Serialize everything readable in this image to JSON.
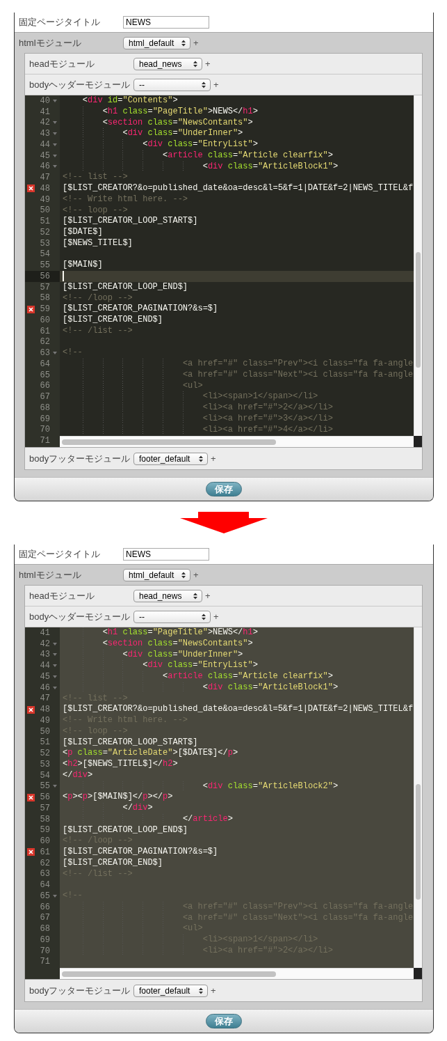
{
  "panels": [
    {
      "page_title": {
        "label": "固定ページタイトル",
        "value": "NEWS"
      },
      "html_module": {
        "label": "htmlモジュール",
        "value": "html_default",
        "add": "+"
      },
      "head_module": {
        "label": "headモジュール",
        "value": "head_news",
        "add": "+"
      },
      "body_header_module": {
        "label": "bodyヘッダーモジュール",
        "value": "--",
        "add": "+"
      },
      "editor": {
        "selected": false,
        "lines": [
          {
            "number": "40",
            "fold": true,
            "error": false,
            "active": false,
            "tokens": [
              {
                "kind": "plain",
                "text": "    <"
              },
              {
                "kind": "tag",
                "text": "div"
              },
              {
                "kind": "attr",
                "text": " id"
              },
              {
                "kind": "plain",
                "text": "="
              },
              {
                "kind": "string",
                "text": "\"Contents\""
              },
              {
                "kind": "plain",
                "text": ">"
              }
            ]
          },
          {
            "number": "41",
            "fold": false,
            "error": false,
            "active": false,
            "tokens": [
              {
                "kind": "plain",
                "text": "        <"
              },
              {
                "kind": "tag",
                "text": "h1"
              },
              {
                "kind": "attr",
                "text": " class"
              },
              {
                "kind": "plain",
                "text": "="
              },
              {
                "kind": "string",
                "text": "\"PageTitle\""
              },
              {
                "kind": "plain",
                "text": ">NEWS</"
              },
              {
                "kind": "tag",
                "text": "h1"
              },
              {
                "kind": "plain",
                "text": ">"
              }
            ]
          },
          {
            "number": "42",
            "fold": true,
            "error": false,
            "active": false,
            "tokens": [
              {
                "kind": "plain",
                "text": "        <"
              },
              {
                "kind": "tag",
                "text": "section"
              },
              {
                "kind": "attr",
                "text": " class"
              },
              {
                "kind": "plain",
                "text": "="
              },
              {
                "kind": "string",
                "text": "\"NewsContants\""
              },
              {
                "kind": "plain",
                "text": ">"
              }
            ]
          },
          {
            "number": "43",
            "fold": true,
            "error": false,
            "active": false,
            "tokens": [
              {
                "kind": "plain",
                "text": "            <"
              },
              {
                "kind": "tag",
                "text": "div"
              },
              {
                "kind": "attr",
                "text": " class"
              },
              {
                "kind": "plain",
                "text": "="
              },
              {
                "kind": "string",
                "text": "\"UnderInner\""
              },
              {
                "kind": "plain",
                "text": ">"
              }
            ]
          },
          {
            "number": "44",
            "fold": true,
            "error": false,
            "active": false,
            "tokens": [
              {
                "kind": "plain",
                "text": "                <"
              },
              {
                "kind": "tag",
                "text": "div"
              },
              {
                "kind": "attr",
                "text": " class"
              },
              {
                "kind": "plain",
                "text": "="
              },
              {
                "kind": "string",
                "text": "\"EntryList\""
              },
              {
                "kind": "plain",
                "text": ">"
              }
            ]
          },
          {
            "number": "45",
            "fold": true,
            "error": false,
            "active": false,
            "tokens": [
              {
                "kind": "plain",
                "text": "                    <"
              },
              {
                "kind": "tag",
                "text": "article"
              },
              {
                "kind": "attr",
                "text": " class"
              },
              {
                "kind": "plain",
                "text": "="
              },
              {
                "kind": "string",
                "text": "\"Article clearfix\""
              },
              {
                "kind": "plain",
                "text": ">"
              }
            ]
          },
          {
            "number": "46",
            "fold": true,
            "error": false,
            "active": false,
            "tokens": [
              {
                "kind": "plain",
                "text": "                            <"
              },
              {
                "kind": "tag",
                "text": "div"
              },
              {
                "kind": "attr",
                "text": " class"
              },
              {
                "kind": "plain",
                "text": "="
              },
              {
                "kind": "string",
                "text": "\"ArticleBlock1\""
              },
              {
                "kind": "plain",
                "text": ">"
              }
            ]
          },
          {
            "number": "47",
            "fold": false,
            "error": false,
            "active": false,
            "tokens": [
              {
                "kind": "comment",
                "text": "<!-- list -->"
              }
            ]
          },
          {
            "number": "48",
            "fold": false,
            "error": true,
            "active": false,
            "tokens": [
              {
                "kind": "plain",
                "text": "[$LIST_CREATOR?&o=published_date&oa=desc&l=5&f=1|DATE&f=2|NEWS_TITEL&f"
              }
            ]
          },
          {
            "number": "49",
            "fold": false,
            "error": false,
            "active": false,
            "tokens": [
              {
                "kind": "comment",
                "text": "<!-- Write html here. -->"
              }
            ]
          },
          {
            "number": "50",
            "fold": false,
            "error": false,
            "active": false,
            "tokens": [
              {
                "kind": "comment",
                "text": "<!-- loop -->"
              }
            ]
          },
          {
            "number": "51",
            "fold": false,
            "error": false,
            "active": false,
            "tokens": [
              {
                "kind": "plain",
                "text": "[$LIST_CREATOR_LOOP_START$]"
              }
            ]
          },
          {
            "number": "52",
            "fold": false,
            "error": false,
            "active": false,
            "tokens": [
              {
                "kind": "plain",
                "text": "[$DATE$]"
              }
            ]
          },
          {
            "number": "53",
            "fold": false,
            "error": false,
            "active": false,
            "tokens": [
              {
                "kind": "plain",
                "text": "[$NEWS_TITEL$]"
              }
            ]
          },
          {
            "number": "54",
            "fold": false,
            "error": false,
            "active": false
          },
          {
            "number": "55",
            "fold": false,
            "error": false,
            "active": false,
            "tokens": [
              {
                "kind": "plain",
                "text": "[$MAIN$]"
              }
            ]
          },
          {
            "number": "56",
            "fold": false,
            "error": false,
            "active": true
          },
          {
            "number": "57",
            "fold": false,
            "error": false,
            "active": false,
            "tokens": [
              {
                "kind": "plain",
                "text": "[$LIST_CREATOR_LOOP_END$]"
              }
            ]
          },
          {
            "number": "58",
            "fold": false,
            "error": false,
            "active": false,
            "tokens": [
              {
                "kind": "comment",
                "text": "<!-- /loop -->"
              }
            ]
          },
          {
            "number": "59",
            "fold": false,
            "error": true,
            "active": false,
            "tokens": [
              {
                "kind": "plain",
                "text": "[$LIST_CREATOR_PAGINATION?&s=$]"
              }
            ]
          },
          {
            "number": "60",
            "fold": false,
            "error": false,
            "active": false,
            "tokens": [
              {
                "kind": "plain",
                "text": "[$LIST_CREATOR_END$]"
              }
            ]
          },
          {
            "number": "61",
            "fold": false,
            "error": false,
            "active": false,
            "tokens": [
              {
                "kind": "comment",
                "text": "<!-- /list -->"
              }
            ]
          },
          {
            "number": "62",
            "fold": false,
            "error": false,
            "active": false
          },
          {
            "number": "63",
            "fold": true,
            "error": false,
            "active": false,
            "tokens": [
              {
                "kind": "comment",
                "text": "<!--"
              }
            ]
          },
          {
            "number": "64",
            "fold": false,
            "error": false,
            "active": false,
            "tokens": [
              {
                "kind": "comment",
                "text": "                        <a href=\"#\" class=\"Prev\"><i class=\"fa fa-angle"
              }
            ]
          },
          {
            "number": "65",
            "fold": false,
            "error": false,
            "active": false,
            "tokens": [
              {
                "kind": "comment",
                "text": "                        <a href=\"#\" class=\"Next\"><i class=\"fa fa-angle"
              }
            ]
          },
          {
            "number": "66",
            "fold": false,
            "error": false,
            "active": false,
            "tokens": [
              {
                "kind": "comment",
                "text": "                        <ul>"
              }
            ]
          },
          {
            "number": "67",
            "fold": false,
            "error": false,
            "active": false,
            "tokens": [
              {
                "kind": "comment",
                "text": "                            <li><span>1</span></li>"
              }
            ]
          },
          {
            "number": "68",
            "fold": false,
            "error": false,
            "active": false,
            "tokens": [
              {
                "kind": "comment",
                "text": "                            <li><a href=\"#\">2</a></li>"
              }
            ]
          },
          {
            "number": "69",
            "fold": false,
            "error": false,
            "active": false,
            "tokens": [
              {
                "kind": "comment",
                "text": "                            <li><a href=\"#\">3</a></li>"
              }
            ]
          },
          {
            "number": "70",
            "fold": false,
            "error": false,
            "active": false,
            "tokens": [
              {
                "kind": "comment",
                "text": "                            <li><a href=\"#\">4</a></li>"
              }
            ]
          },
          {
            "number": "71",
            "fold": false,
            "error": false,
            "active": false
          }
        ]
      },
      "body_footer_module": {
        "label": "bodyフッターモジュール",
        "value": "footer_default",
        "add": "+"
      },
      "save_button": "保存"
    },
    {
      "page_title": {
        "label": "固定ページタイトル",
        "value": "NEWS"
      },
      "html_module": {
        "label": "htmlモジュール",
        "value": "html_default",
        "add": "+"
      },
      "head_module": {
        "label": "headモジュール",
        "value": "head_news",
        "add": "+"
      },
      "body_header_module": {
        "label": "bodyヘッダーモジュール",
        "value": "--",
        "add": "+"
      },
      "editor": {
        "selected": true,
        "lines": [
          {
            "number": "41",
            "fold": false,
            "error": false,
            "active": false,
            "tokens": [
              {
                "kind": "plain",
                "text": "        <"
              },
              {
                "kind": "tag",
                "text": "h1"
              },
              {
                "kind": "attr",
                "text": " class"
              },
              {
                "kind": "plain",
                "text": "="
              },
              {
                "kind": "string",
                "text": "\"PageTitle\""
              },
              {
                "kind": "plain",
                "text": ">NEWS</"
              },
              {
                "kind": "tag",
                "text": "h1"
              },
              {
                "kind": "plain",
                "text": ">"
              }
            ]
          },
          {
            "number": "42",
            "fold": true,
            "error": false,
            "active": false,
            "tokens": [
              {
                "kind": "plain",
                "text": "        <"
              },
              {
                "kind": "tag",
                "text": "section"
              },
              {
                "kind": "attr",
                "text": " class"
              },
              {
                "kind": "plain",
                "text": "="
              },
              {
                "kind": "string",
                "text": "\"NewsContants\""
              },
              {
                "kind": "plain",
                "text": ">"
              }
            ]
          },
          {
            "number": "43",
            "fold": true,
            "error": false,
            "active": false,
            "tokens": [
              {
                "kind": "plain",
                "text": "            <"
              },
              {
                "kind": "tag",
                "text": "div"
              },
              {
                "kind": "attr",
                "text": " class"
              },
              {
                "kind": "plain",
                "text": "="
              },
              {
                "kind": "string",
                "text": "\"UnderInner\""
              },
              {
                "kind": "plain",
                "text": ">"
              }
            ]
          },
          {
            "number": "44",
            "fold": true,
            "error": false,
            "active": false,
            "tokens": [
              {
                "kind": "plain",
                "text": "                <"
              },
              {
                "kind": "tag",
                "text": "div"
              },
              {
                "kind": "attr",
                "text": " class"
              },
              {
                "kind": "plain",
                "text": "="
              },
              {
                "kind": "string",
                "text": "\"EntryList\""
              },
              {
                "kind": "plain",
                "text": ">"
              }
            ]
          },
          {
            "number": "45",
            "fold": true,
            "error": false,
            "active": false,
            "tokens": [
              {
                "kind": "plain",
                "text": "                    <"
              },
              {
                "kind": "tag",
                "text": "article"
              },
              {
                "kind": "attr",
                "text": " class"
              },
              {
                "kind": "plain",
                "text": "="
              },
              {
                "kind": "string",
                "text": "\"Article clearfix\""
              },
              {
                "kind": "plain",
                "text": ">"
              }
            ]
          },
          {
            "number": "46",
            "fold": true,
            "error": false,
            "active": false,
            "tokens": [
              {
                "kind": "plain",
                "text": "                            <"
              },
              {
                "kind": "tag",
                "text": "div"
              },
              {
                "kind": "attr",
                "text": " class"
              },
              {
                "kind": "plain",
                "text": "="
              },
              {
                "kind": "string",
                "text": "\"ArticleBlock1\""
              },
              {
                "kind": "plain",
                "text": ">"
              }
            ]
          },
          {
            "number": "47",
            "fold": false,
            "error": false,
            "active": false,
            "tokens": [
              {
                "kind": "comment",
                "text": "<!-- list -->"
              }
            ]
          },
          {
            "number": "48",
            "fold": false,
            "error": true,
            "active": false,
            "tokens": [
              {
                "kind": "plain",
                "text": "[$LIST_CREATOR?&o=published_date&oa=desc&l=5&f=1|DATE&f=2|NEWS_TITEL&f"
              }
            ]
          },
          {
            "number": "49",
            "fold": false,
            "error": false,
            "active": false,
            "tokens": [
              {
                "kind": "comment",
                "text": "<!-- Write html here. -->"
              }
            ]
          },
          {
            "number": "50",
            "fold": false,
            "error": false,
            "active": false,
            "tokens": [
              {
                "kind": "comment",
                "text": "<!-- loop -->"
              }
            ]
          },
          {
            "number": "51",
            "fold": false,
            "error": false,
            "active": false,
            "tokens": [
              {
                "kind": "plain",
                "text": "[$LIST_CREATOR_LOOP_START$]"
              }
            ]
          },
          {
            "number": "52",
            "fold": false,
            "error": false,
            "active": false,
            "tokens": [
              {
                "kind": "plain",
                "text": "<"
              },
              {
                "kind": "tag",
                "text": "p"
              },
              {
                "kind": "attr",
                "text": " class"
              },
              {
                "kind": "plain",
                "text": "="
              },
              {
                "kind": "string",
                "text": "\"ArticleDate\""
              },
              {
                "kind": "plain",
                "text": ">[$DATE$]</"
              },
              {
                "kind": "tag",
                "text": "p"
              },
              {
                "kind": "plain",
                "text": ">"
              }
            ]
          },
          {
            "number": "53",
            "fold": false,
            "error": false,
            "active": false,
            "tokens": [
              {
                "kind": "plain",
                "text": "<"
              },
              {
                "kind": "tag",
                "text": "h2"
              },
              {
                "kind": "plain",
                "text": ">[$NEWS_TITEL$]</"
              },
              {
                "kind": "tag",
                "text": "h2"
              },
              {
                "kind": "plain",
                "text": ">"
              }
            ]
          },
          {
            "number": "54",
            "fold": false,
            "error": false,
            "active": false,
            "tokens": [
              {
                "kind": "plain",
                "text": "</"
              },
              {
                "kind": "tag",
                "text": "div"
              },
              {
                "kind": "plain",
                "text": ">"
              }
            ]
          },
          {
            "number": "55",
            "fold": true,
            "error": false,
            "active": false,
            "tokens": [
              {
                "kind": "plain",
                "text": "                            <"
              },
              {
                "kind": "tag",
                "text": "div"
              },
              {
                "kind": "attr",
                "text": " class"
              },
              {
                "kind": "plain",
                "text": "="
              },
              {
                "kind": "string",
                "text": "\"ArticleBlock2\""
              },
              {
                "kind": "plain",
                "text": ">"
              }
            ]
          },
          {
            "number": "56",
            "fold": false,
            "error": true,
            "active": false,
            "tokens": [
              {
                "kind": "plain",
                "text": "<"
              },
              {
                "kind": "tag",
                "text": "p"
              },
              {
                "kind": "plain",
                "text": "><"
              },
              {
                "kind": "tag",
                "text": "p"
              },
              {
                "kind": "plain",
                "text": ">[$MAIN$]</"
              },
              {
                "kind": "tag",
                "text": "p"
              },
              {
                "kind": "plain",
                "text": "></"
              },
              {
                "kind": "tag",
                "text": "p"
              },
              {
                "kind": "plain",
                "text": ">"
              }
            ]
          },
          {
            "number": "57",
            "fold": false,
            "error": false,
            "active": false,
            "tokens": [
              {
                "kind": "plain",
                "text": "            </"
              },
              {
                "kind": "tag",
                "text": "div"
              },
              {
                "kind": "plain",
                "text": ">"
              }
            ]
          },
          {
            "number": "58",
            "fold": false,
            "error": false,
            "active": false,
            "tokens": [
              {
                "kind": "plain",
                "text": "                        </"
              },
              {
                "kind": "tag",
                "text": "article"
              },
              {
                "kind": "plain",
                "text": ">"
              }
            ]
          },
          {
            "number": "59",
            "fold": false,
            "error": false,
            "active": false,
            "tokens": [
              {
                "kind": "plain",
                "text": "[$LIST_CREATOR_LOOP_END$]"
              }
            ]
          },
          {
            "number": "60",
            "fold": false,
            "error": false,
            "active": false,
            "tokens": [
              {
                "kind": "comment",
                "text": "<!-- /loop -->"
              }
            ]
          },
          {
            "number": "61",
            "fold": false,
            "error": true,
            "active": false,
            "tokens": [
              {
                "kind": "plain",
                "text": "[$LIST_CREATOR_PAGINATION?&s=$]"
              }
            ]
          },
          {
            "number": "62",
            "fold": false,
            "error": false,
            "active": false,
            "tokens": [
              {
                "kind": "plain",
                "text": "[$LIST_CREATOR_END$]"
              }
            ]
          },
          {
            "number": "63",
            "fold": false,
            "error": false,
            "active": false,
            "tokens": [
              {
                "kind": "comment",
                "text": "<!-- /list -->"
              }
            ]
          },
          {
            "number": "64",
            "fold": false,
            "error": false,
            "active": false
          },
          {
            "number": "65",
            "fold": true,
            "error": false,
            "active": false,
            "tokens": [
              {
                "kind": "comment",
                "text": "<!--"
              }
            ]
          },
          {
            "number": "66",
            "fold": false,
            "error": false,
            "active": false,
            "tokens": [
              {
                "kind": "comment",
                "text": "                        <a href=\"#\" class=\"Prev\"><i class=\"fa fa-angle"
              }
            ]
          },
          {
            "number": "67",
            "fold": false,
            "error": false,
            "active": false,
            "tokens": [
              {
                "kind": "comment",
                "text": "                        <a href=\"#\" class=\"Next\"><i class=\"fa fa-angle"
              }
            ]
          },
          {
            "number": "68",
            "fold": false,
            "error": false,
            "active": false,
            "tokens": [
              {
                "kind": "comment",
                "text": "                        <ul>"
              }
            ]
          },
          {
            "number": "69",
            "fold": false,
            "error": false,
            "active": false,
            "tokens": [
              {
                "kind": "comment",
                "text": "                            <li><span>1</span></li>"
              }
            ]
          },
          {
            "number": "70",
            "fold": false,
            "error": false,
            "active": false,
            "tokens": [
              {
                "kind": "comment",
                "text": "                            <li><a href=\"#\">2</a></li>"
              }
            ]
          },
          {
            "number": "71",
            "fold": false,
            "error": false,
            "active": false
          }
        ]
      },
      "body_footer_module": {
        "label": "bodyフッターモジュール",
        "value": "footer_default",
        "add": "+"
      },
      "save_button": "保存"
    }
  ]
}
